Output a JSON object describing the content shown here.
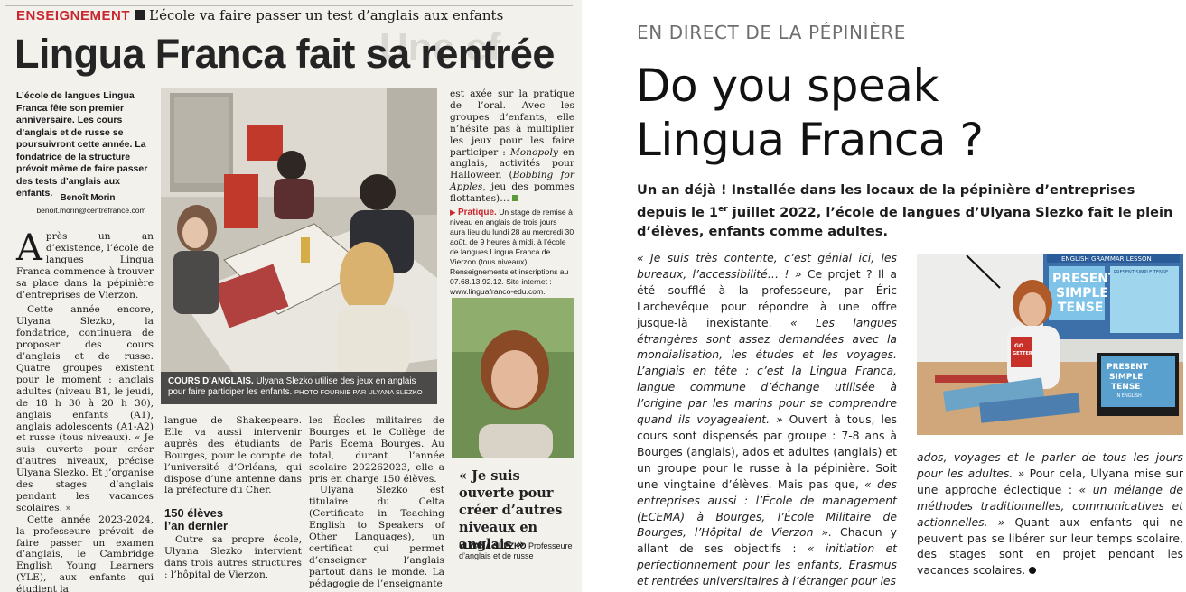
{
  "left_article": {
    "section": "ENSEIGNEMENT",
    "kicker": "L’école va faire passer un test d’anglais aux enfants",
    "bg_ghost_text": "Une ef",
    "title": "Lingua Franca fait sa rentrée",
    "lede": "L’école de langues Lingua Franca fête son premier anniversaire. Les cours d’anglais et de russe se poursuivront cette année. La fondatrice de la structure prévoit même de faire passer des tests d’anglais aux enfants.",
    "author": "Benoît Morin",
    "author_email": "benoit.morin@centrefrance.com",
    "col1_dropcap": "A",
    "col1_first": "près un an d’existence, l’école de langues Lingua Franca commence à trouver sa place dans la pépinière d’entreprises de Vierzon.",
    "col1_p2": "Cette année encore, Ulyana Slezko, la fondatrice, continuera de proposer des cours d’anglais et de russe. Quatre groupes existent pour le moment : anglais adultes (niveau B1, le jeudi, de 18 h 30 à 20 h 30), anglais enfants (A1), anglais adolescents (A1-A2) et russe (tous niveaux). « Je suis ouverte pour créer d’autres niveaux, précise Ulyana Slezko. Et j’organise des stages d’anglais pendant les vacances scolaires. »",
    "col1_p3": "Cette année 2023-2024, la professeure prévoit de faire passer un examen d’anglais, le Cambridge English Young Learners (YLE), aux enfants qui étudient la",
    "photo_caption_label": "COURS D’ANGLAIS.",
    "photo_caption": "Ulyana Slezko utilise des jeux en anglais pour faire participer les enfants.",
    "photo_credit": "PHOTO FOURNIE PAR ULYANA SLEZKO",
    "col2_p1": "langue de Shakespeare. Elle va aussi intervenir auprès des étudiants de Bourges, pour le compte de l’université d’Orléans, qui dispose d’une antenne dans la préfecture du Cher.",
    "subhead_line1": "150 élèves",
    "subhead_line2": "l’an dernier",
    "col2_p2": "Outre sa propre école, Ulyana Slezko intervient dans trois autres structures : l’hôpital de Vierzon,",
    "col3_p1": "les Écoles militaires de Bourges et le Collège de Paris Ecema Bourges. Au total, durant l’année scolaire 202262023, elle a pris en charge 150 élèves.",
    "col3_p2": "Ulyana Slezko est titulaire du Celta (Certificate in Teaching English to Speakers of Other Languages), un certificat qui permet d’enseigner l’anglais partout dans le monde. La pédagogie de l’enseignante",
    "col4_a": "est axée sur la pratique de l’oral. Avec les groupes d’enfants, elle n’hésite pas à multiplier les jeux pour les faire participer : ",
    "col4_monopoly": "Monopoly",
    "col4_b": " en anglais, activités pour Halloween (",
    "col4_bobbing": "Bobbing for Apples",
    "col4_c": ", jeu des pommes flottantes)…",
    "pratique_label": "Pratique.",
    "pratique_text": "Un stage de remise à niveau en anglais de trois jours aura lieu du lundi 28 au mercredi 30 août, de 9 heures à midi, à l’école de langues Lingua Franca de Vierzon (tous niveaux). Renseignements et inscriptions au 07.68.13.92.12. Site internet : www.linguafranco-edu.com.",
    "pull_quote": "« Je suis ouverte pour créer d’autres niveaux en anglais »",
    "quote_name": "ULYANA SLEZKO",
    "quote_role": "Professeure d’anglais et de russe"
  },
  "right_article": {
    "section": "EN DIRECT DE LA PÉPINIÈRE",
    "title_line1": "Do you speak",
    "title_line2": "Lingua Franca ?",
    "lede_a": "Un an déjà ! Installée dans les locaux de la pépinière d’entreprises depuis le 1",
    "lede_sup": "er",
    "lede_b": " juillet 2022, l’école de langues d’Ulyana Slezko fait le plein d’élèves, enfants comme adultes.",
    "p1_q1": "« Je suis très contente, c’est génial ici, les bureaux, l’accessibilité… ! »",
    "p1_a": " Ce projet ? Il a été soufflé à la professeure, par Éric Larchevêque pour répondre à une offre jusque-là inexistante. ",
    "p1_q2": "« Les langues étrangères sont assez demandées avec la mondialisation, les études et les voyages. L’anglais en tête : c’est la Lingua Franca, langue commune d’échange utilisée à l’origine par les marins pour se comprendre quand ils voyageaient. »",
    "p1_b": " Ouvert à tous, les cours sont dispensés par groupe : 7-8 ans à Bourges (anglais), ados et adultes (anglais) et un groupe pour le russe à la pépinière. Soit une vingtaine d’élèves. Mais pas que, ",
    "p1_q3": "« des entreprises aussi : l’École de management (ECEMA) à Bourges, l’École Militaire de Bourges, l’Hôpital de Vierzon ».",
    "p1_c": " Chacun y allant de ses objectifs : ",
    "p1_q4": "« initiation et perfectionnement pour les enfants, Erasmus et rentrées universitaires à l’étranger pour les",
    "p2_q1": "ados, voyages et le parler de tous les jours pour les adultes. »",
    "p2_a": " Pour cela, Ulyana mise sur une approche éclectique : ",
    "p2_q2": "« un mélange de méthodes traditionnelles, communicatives et actionnelles. »",
    "p2_b": " Quant aux enfants qui ne peuvent pas se libérer sur leur temps scolaire, des stages sont en projet pendant les vacances scolaires. ",
    "photo_board_header": "ENGLISH GRAMMAR LESSON",
    "photo_board_text": [
      "PRESENT",
      "SIMPLE",
      "TENSE"
    ],
    "photo_board_sub": "PRESENT SIMPLE TENSE",
    "photo_laptop_text": [
      "PRESENT",
      "SIMPLE",
      "TENSE"
    ],
    "photo_laptop_sub": "IN ENGLISH",
    "photo_book_text": [
      "GO",
      "GETTER"
    ]
  },
  "colors": {
    "section_red": "#c8282f",
    "pratique_square": "#5a9a3c",
    "paper": "#f3f1ec"
  }
}
